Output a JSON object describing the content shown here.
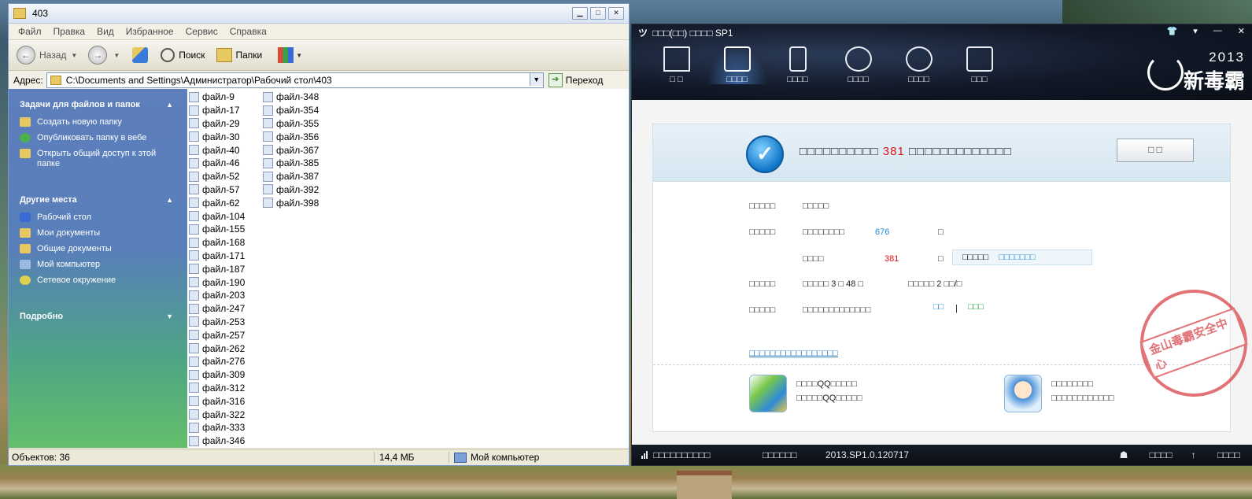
{
  "explorer": {
    "title": "403",
    "menu": [
      "Файл",
      "Правка",
      "Вид",
      "Избранное",
      "Сервис",
      "Справка"
    ],
    "toolbar": {
      "back": "Назад",
      "search": "Поиск",
      "folders": "Папки"
    },
    "address": {
      "label": "Адрес:",
      "path": "C:\\Documents and Settings\\Администратор\\Рабочий стол\\403",
      "go": "Переход"
    },
    "tasks": {
      "header": "Задачи для файлов и папок",
      "items": [
        "Создать новую папку",
        "Опубликовать папку в вебе",
        "Открыть общий доступ к этой папке"
      ]
    },
    "places": {
      "header": "Другие места",
      "items": [
        "Рабочий стол",
        "Мои документы",
        "Общие документы",
        "Мой компьютер",
        "Сетевое окружение"
      ]
    },
    "details": {
      "header": "Подробно"
    },
    "files_col1": [
      "файл-9",
      "файл-17",
      "файл-29",
      "файл-30",
      "файл-40",
      "файл-46",
      "файл-52",
      "файл-57",
      "файл-62",
      "файл-104",
      "файл-155",
      "файл-168",
      "файл-171",
      "файл-187",
      "файл-190",
      "файл-203",
      "файл-247",
      "файл-253",
      "файл-257",
      "файл-262",
      "файл-276",
      "файл-309",
      "файл-312",
      "файл-316",
      "файл-322",
      "файл-333",
      "файл-346"
    ],
    "files_col2": [
      "файл-348",
      "файл-354",
      "файл-355",
      "файл-356",
      "файл-367",
      "файл-385",
      "файл-387",
      "файл-392",
      "файл-398"
    ],
    "status": {
      "objects": "Объектов: 36",
      "size": "14,4 МБ",
      "location": "Мой компьютер"
    }
  },
  "antivirus": {
    "title": "□□□(□□) □□□□ SP1",
    "nav": [
      "□ □",
      "□□□□",
      "□□□□",
      "□□□□",
      "□□□□",
      "□□□"
    ],
    "brand_year": "2013",
    "brand_name": "新毒霸",
    "result": {
      "pre": "□□□□□□□□□□ ",
      "count": "381",
      "post": " □□□□□□□□□□□□□"
    },
    "ok_button": "□ □",
    "rows": {
      "r1_label": "□□□□□",
      "r1_value": "□□□□□",
      "r2_label": "□□□□□",
      "r2_text": "□□□□□□□□",
      "r2_num": "676",
      "r2_box": "□",
      "r3_text": "□□□□",
      "r3_num": "381",
      "r3_box": "□",
      "tip_text": "□□□□□",
      "tip_link": "□□□□□□□",
      "r4_label": "□□□□□",
      "r4_a": "□□□□□ 3 □ 48 □",
      "r4_b": "□□□□□ 2 □□/□",
      "r5_label": "□□□□□",
      "r5_text": "□□□□□□□□□□□□□",
      "r5_link1": "□□",
      "r5_sep": "|",
      "r5_link2": "□□□"
    },
    "bottom_link": "□□□□□□□□□□□□□□□□□",
    "products": [
      {
        "line1": "□□□□QQ□□□□□",
        "line2": "□□□□□QQ□□□□□"
      },
      {
        "line1": "□□□□□□□□",
        "line2": "□□□□□□□□□□□□"
      }
    ],
    "stamp_text": "金山毒霸安全中心",
    "status": {
      "left": "□□□□□□□□□□",
      "mid": "□□□□□□",
      "version": "2013.SP1.0.120717",
      "r1": "□□□□",
      "r2": "□□□□"
    }
  }
}
